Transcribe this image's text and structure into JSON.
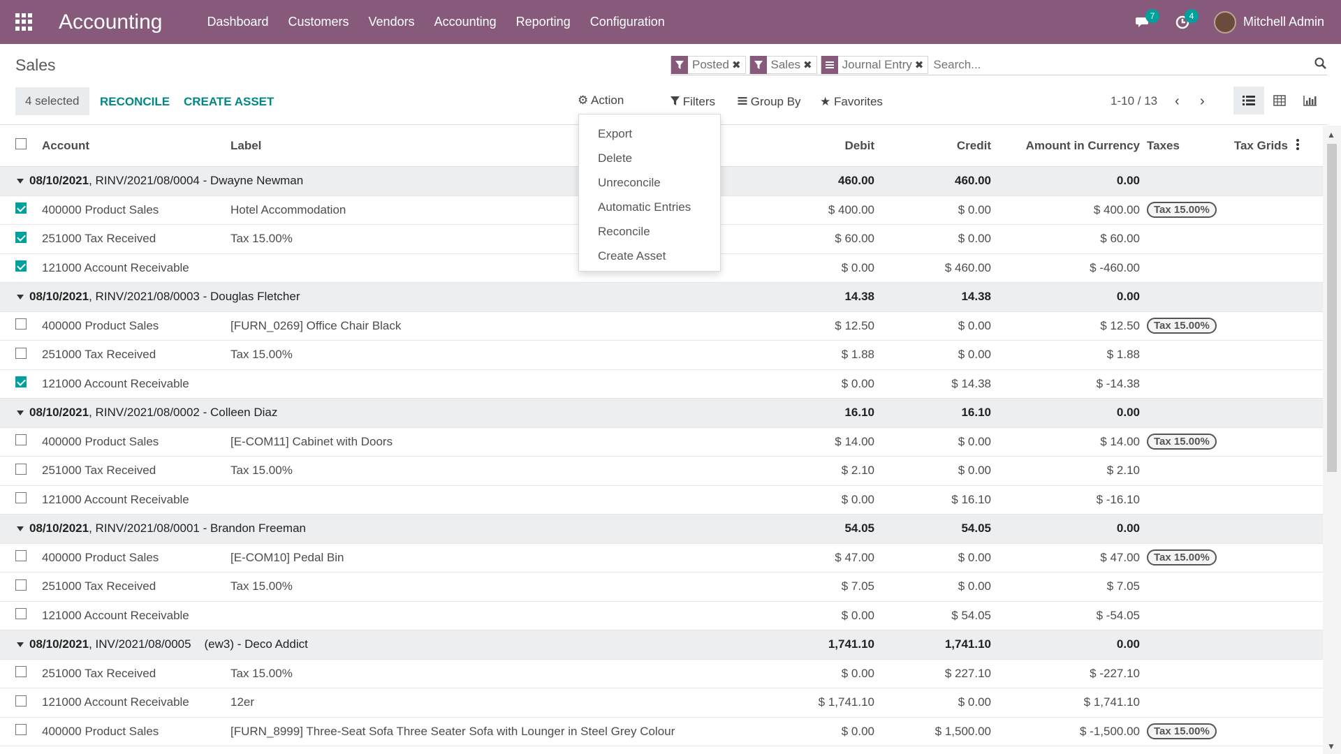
{
  "navbar": {
    "brand": "Accounting",
    "menu": [
      "Dashboard",
      "Customers",
      "Vendors",
      "Accounting",
      "Reporting",
      "Configuration"
    ],
    "messages_count": "7",
    "activities_count": "4",
    "user": "Mitchell Admin"
  },
  "breadcrumb": "Sales",
  "search": {
    "facets": [
      {
        "label": "Posted",
        "icon": "filter-icon"
      },
      {
        "label": "Sales",
        "icon": "filter-icon"
      },
      {
        "label": "Journal Entry",
        "icon": "groupby-icon"
      }
    ],
    "placeholder": "Search..."
  },
  "toolbar": {
    "selected": "4 selected",
    "reconcile": "RECONCILE",
    "create_asset": "CREATE ASSET",
    "action": "Action",
    "filters": "Filters",
    "group_by": "Group By",
    "favorites": "Favorites",
    "pager": "1-10 / 13"
  },
  "action_menu": [
    "Export",
    "Delete",
    "Unreconcile",
    "Automatic Entries",
    "Reconcile",
    "Create Asset"
  ],
  "columns": {
    "account": "Account",
    "label": "Label",
    "debit": "Debit",
    "credit": "Credit",
    "amount": "Amount in Currency",
    "taxes": "Taxes",
    "tax_grids": "Tax Grids"
  },
  "groups": [
    {
      "date": "08/10/2021",
      "title": ", RINV/2021/08/0004 - Dwayne Newman",
      "debit": "460.00",
      "credit": "460.00",
      "amount": "0.00",
      "lines": [
        {
          "checked": true,
          "account": "400000 Product Sales",
          "label": "Hotel Accommodation",
          "debit": "$ 400.00",
          "credit": "$ 0.00",
          "amount": "$ 400.00",
          "tax": "Tax 15.00%"
        },
        {
          "checked": true,
          "account": "251000 Tax Received",
          "label": "Tax 15.00%",
          "debit": "$ 60.00",
          "credit": "$ 0.00",
          "amount": "$ 60.00",
          "tax": ""
        },
        {
          "checked": true,
          "account": "121000 Account Receivable",
          "label": "",
          "debit": "$ 0.00",
          "credit": "$ 460.00",
          "amount": "$ -460.00",
          "tax": ""
        }
      ]
    },
    {
      "date": "08/10/2021",
      "title": ", RINV/2021/08/0003 - Douglas Fletcher",
      "debit": "14.38",
      "credit": "14.38",
      "amount": "0.00",
      "lines": [
        {
          "checked": false,
          "account": "400000 Product Sales",
          "label": "[FURN_0269] Office Chair Black",
          "debit": "$ 12.50",
          "credit": "$ 0.00",
          "amount": "$ 12.50",
          "tax": "Tax 15.00%"
        },
        {
          "checked": false,
          "account": "251000 Tax Received",
          "label": "Tax 15.00%",
          "debit": "$ 1.88",
          "credit": "$ 0.00",
          "amount": "$ 1.88",
          "tax": ""
        },
        {
          "checked": true,
          "account": "121000 Account Receivable",
          "label": "",
          "debit": "$ 0.00",
          "credit": "$ 14.38",
          "amount": "$ -14.38",
          "tax": ""
        }
      ]
    },
    {
      "date": "08/10/2021",
      "title": ", RINV/2021/08/0002 - Colleen Diaz",
      "debit": "16.10",
      "credit": "16.10",
      "amount": "0.00",
      "lines": [
        {
          "checked": false,
          "account": "400000 Product Sales",
          "label": "[E-COM11] Cabinet with Doors",
          "debit": "$ 14.00",
          "credit": "$ 0.00",
          "amount": "$ 14.00",
          "tax": "Tax 15.00%"
        },
        {
          "checked": false,
          "account": "251000 Tax Received",
          "label": "Tax 15.00%",
          "debit": "$ 2.10",
          "credit": "$ 0.00",
          "amount": "$ 2.10",
          "tax": ""
        },
        {
          "checked": false,
          "account": "121000 Account Receivable",
          "label": "",
          "debit": "$ 0.00",
          "credit": "$ 16.10",
          "amount": "$ -16.10",
          "tax": ""
        }
      ]
    },
    {
      "date": "08/10/2021",
      "title": ", RINV/2021/08/0001 - Brandon Freeman",
      "debit": "54.05",
      "credit": "54.05",
      "amount": "0.00",
      "lines": [
        {
          "checked": false,
          "account": "400000 Product Sales",
          "label": "[E-COM10] Pedal Bin",
          "debit": "$ 47.00",
          "credit": "$ 0.00",
          "amount": "$ 47.00",
          "tax": "Tax 15.00%"
        },
        {
          "checked": false,
          "account": "251000 Tax Received",
          "label": "Tax 15.00%",
          "debit": "$ 7.05",
          "credit": "$ 0.00",
          "amount": "$ 7.05",
          "tax": ""
        },
        {
          "checked": false,
          "account": "121000 Account Receivable",
          "label": "",
          "debit": "$ 0.00",
          "credit": "$ 54.05",
          "amount": "$ -54.05",
          "tax": ""
        }
      ]
    },
    {
      "date": "08/10/2021",
      "title": ", INV/2021/08/0005    (ew3) - Deco Addict",
      "debit": "1,741.10",
      "credit": "1,741.10",
      "amount": "0.00",
      "lines": [
        {
          "checked": false,
          "account": "251000 Tax Received",
          "label": "Tax 15.00%",
          "debit": "$ 0.00",
          "credit": "$ 227.10",
          "amount": "$ -227.10",
          "tax": ""
        },
        {
          "checked": false,
          "account": "121000 Account Receivable",
          "label": "12er",
          "debit": "$ 1,741.10",
          "credit": "$ 0.00",
          "amount": "$ 1,741.10",
          "tax": ""
        },
        {
          "checked": false,
          "account": "400000 Product Sales",
          "label": "[FURN_8999] Three-Seat Sofa Three Seater Sofa with Lounger in Steel Grey Colour",
          "debit": "$ 0.00",
          "credit": "$ 1,500.00",
          "amount": "$ -1,500.00",
          "tax": "Tax 15.00%"
        }
      ]
    }
  ],
  "colors": {
    "brand": "#875a7b",
    "accent": "#00a09d",
    "link": "#018786"
  }
}
